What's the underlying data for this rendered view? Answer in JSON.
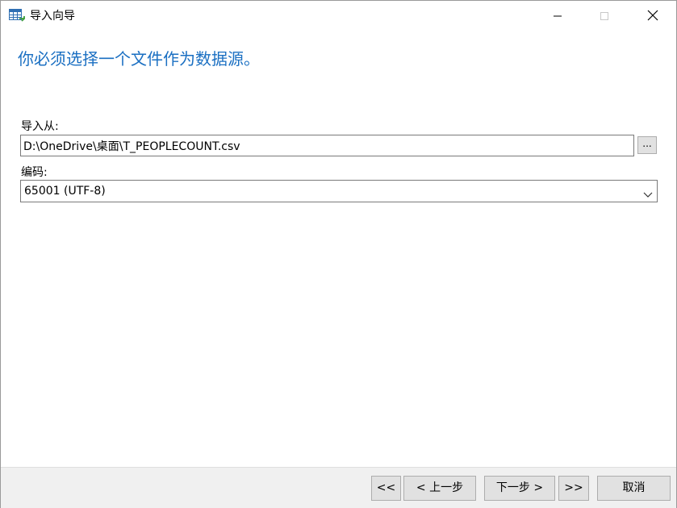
{
  "window": {
    "title": "导入向导",
    "app_icon": "table-import-icon"
  },
  "controls": {
    "minimize_icon": "minimize-icon",
    "maximize_icon": "maximize-icon",
    "close_icon": "close-icon"
  },
  "main": {
    "heading": "你必须选择一个文件作为数据源。",
    "import_from_label": "导入从:",
    "file_path": "D:\\OneDrive\\桌面\\T_PEOPLECOUNT.csv",
    "browse_label": "...",
    "encoding_label": "编码:",
    "encoding_value": "65001 (UTF-8)"
  },
  "footer": {
    "first_label": "<<",
    "prev_label": "< 上一步",
    "next_label": "下一步 >",
    "last_label": ">>",
    "cancel_label": "取消"
  },
  "colors": {
    "heading": "#1a6fc2",
    "footer_bg": "#f0f0f0",
    "button_bg": "#e1e1e1"
  }
}
